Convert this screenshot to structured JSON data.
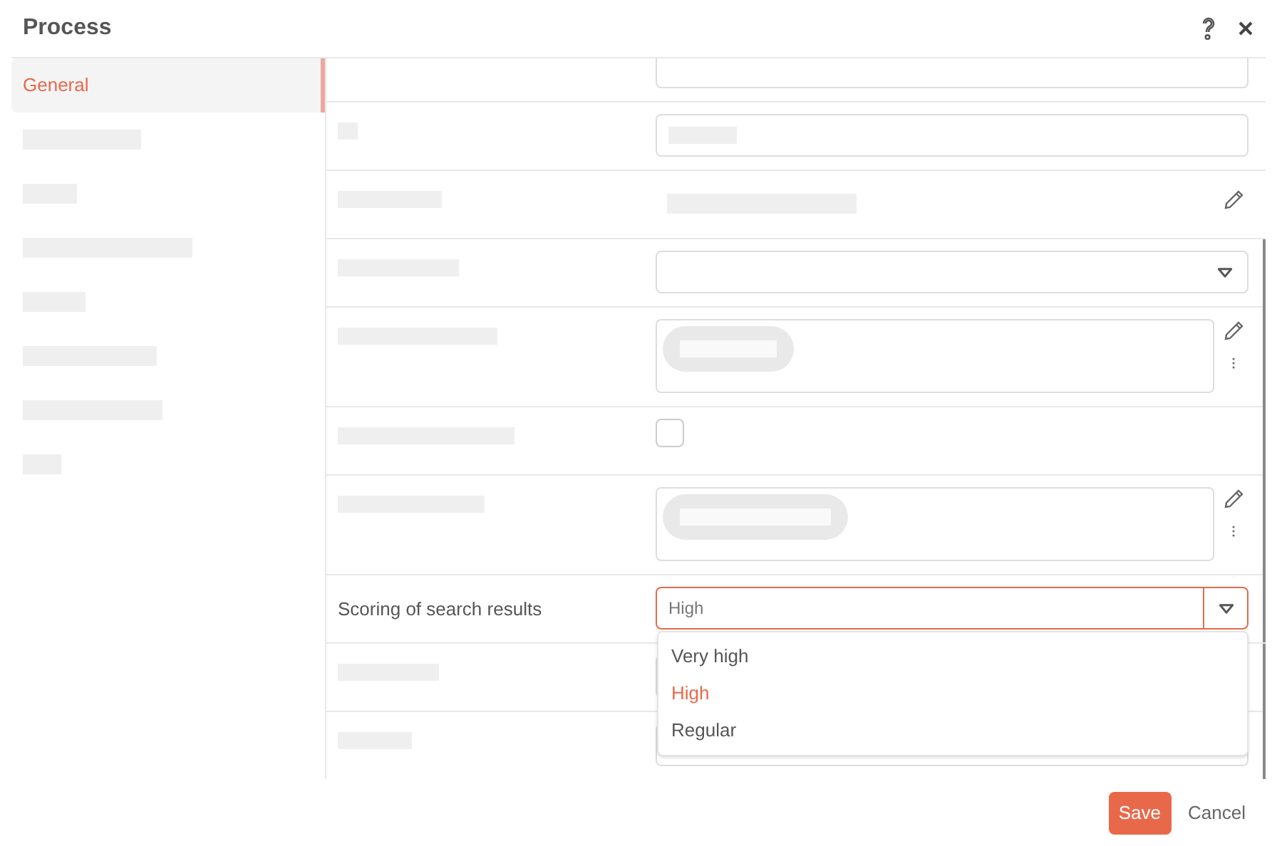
{
  "window": {
    "title": "Process"
  },
  "sidebar": {
    "items": [
      {
        "label": "General",
        "selected": true
      },
      {
        "kind": "redacted",
        "selected": false
      },
      {
        "kind": "redacted",
        "selected": false
      },
      {
        "kind": "redacted",
        "selected": false
      },
      {
        "kind": "redacted",
        "selected": false
      },
      {
        "kind": "redacted",
        "selected": false
      },
      {
        "kind": "redacted",
        "selected": false
      },
      {
        "kind": "redacted",
        "selected": false
      }
    ]
  },
  "form": {
    "rows": [
      {
        "kind": "text"
      },
      {
        "kind": "text"
      },
      {
        "kind": "readonly"
      },
      {
        "kind": "select",
        "open": false
      },
      {
        "kind": "tags"
      },
      {
        "kind": "checkbox",
        "checked": false
      },
      {
        "kind": "tags"
      },
      {
        "kind": "select",
        "label": "Scoring of search results",
        "value": "High",
        "open": true,
        "options": [
          {
            "label": "Very high",
            "selected": false
          },
          {
            "label": "High",
            "selected": true
          },
          {
            "label": "Regular",
            "selected": false
          }
        ]
      },
      {
        "kind": "text"
      },
      {
        "kind": "text"
      }
    ]
  },
  "buttons": [
    {
      "label": "Save",
      "kind": "primary"
    },
    {
      "label": "Cancel",
      "kind": "secondary"
    }
  ]
}
